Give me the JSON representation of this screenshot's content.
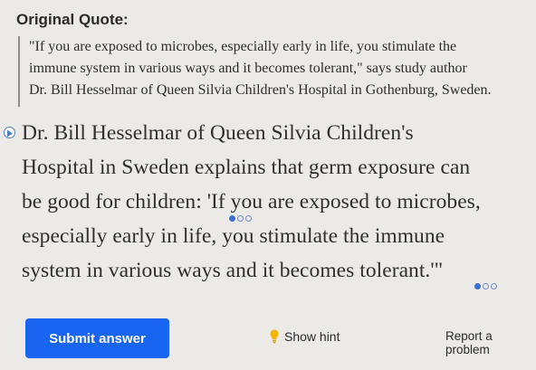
{
  "original_quote": {
    "heading": "Original Quote:",
    "lines": [
      "\"If you are exposed to microbes, especially early in life, you stimulate the",
      "immune system in various ways and it becomes tolerant,\" says study author",
      "Dr. Bill Hesselmar of Queen Silvia Children's Hospital in Gothenburg, Sweden."
    ]
  },
  "passage": {
    "lines": [
      "Dr. Bill Hesselmar of Queen Silvia Children's",
      "Hospital in Sweden explains that germ exposure can",
      "be good for children: 'If you are exposed to microbes,",
      "especially early in life, you stimulate the immune",
      "system in various ways and it becomes tolerant.'\""
    ]
  },
  "footer": {
    "submit_label": "Submit answer",
    "hint_label": "Show hint",
    "report_label": "Report a problem"
  },
  "colors": {
    "accent": "#1865f2",
    "dot_fill": "#3c6fd1",
    "hint_bulb": "#f4b400"
  }
}
